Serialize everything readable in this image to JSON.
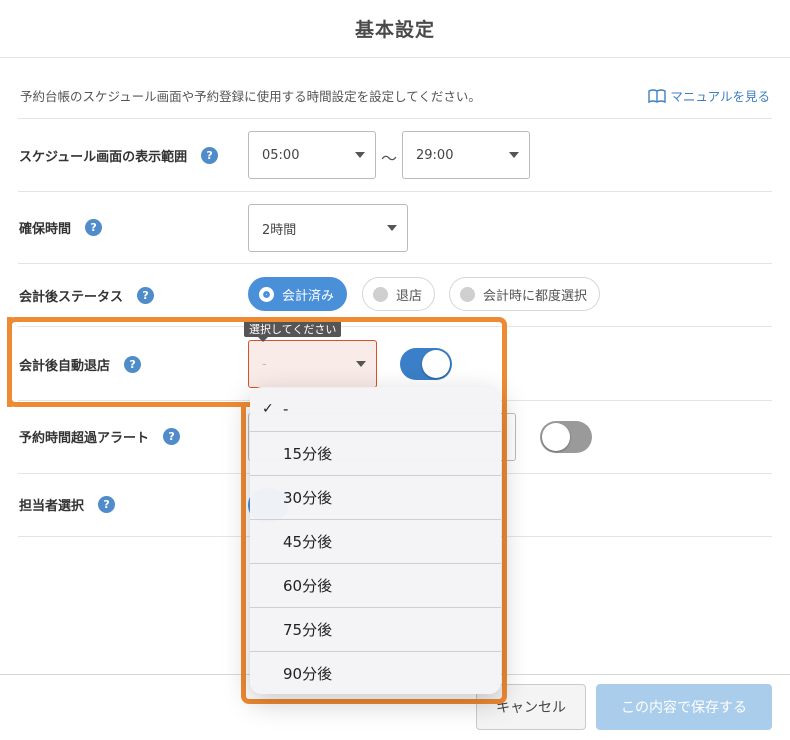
{
  "header": {
    "title": "基本設定"
  },
  "description": "予約台帳のスケジュール画面や予約登録に使用する時間設定を設定してください。",
  "manual_link": {
    "label": "マニュアルを見る"
  },
  "help_glyph": "?",
  "rows": {
    "schedule_range": {
      "label": "スケジュール画面の表示範囲",
      "start": "05:00",
      "separator": "〜",
      "end": "29:00"
    },
    "hold_time": {
      "label": "確保時間",
      "value": "2時間"
    },
    "post_payment_status": {
      "label": "会計後ステータス",
      "options": [
        {
          "label": "会計済み",
          "selected": true
        },
        {
          "label": "退店",
          "selected": false
        },
        {
          "label": "会計時に都度選択",
          "selected": false
        }
      ]
    },
    "auto_leave": {
      "label": "会計後自動退店",
      "value": "-",
      "tooltip": "選択してください",
      "toggle_on": true
    },
    "overtime_alert": {
      "label": "予約時間超過アラート",
      "toggle_on": false
    },
    "staff_select": {
      "label": "担当者選択"
    }
  },
  "dropdown": {
    "check_glyph": "✓",
    "options": [
      {
        "label": "-",
        "checked": true
      },
      {
        "label": "15分後",
        "checked": false
      },
      {
        "label": "30分後",
        "checked": false
      },
      {
        "label": "45分後",
        "checked": false
      },
      {
        "label": "60分後",
        "checked": false
      },
      {
        "label": "75分後",
        "checked": false
      },
      {
        "label": "90分後",
        "checked": false
      }
    ]
  },
  "footer": {
    "cancel_label": "キャンセル",
    "save_label": "この内容で保存する"
  },
  "colors": {
    "accent": "#4a90d9",
    "highlight": "#ef8a34",
    "save_disabled": "#a9cdea"
  }
}
